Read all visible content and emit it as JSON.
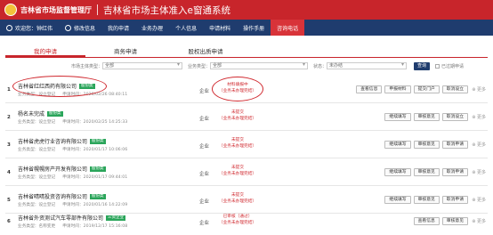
{
  "header": {
    "org_name": "吉林省市场监督管理厅",
    "system_title": "吉林省市场主体准入e窗通系统"
  },
  "menu": [
    {
      "label": "欢迎您：钟红伟",
      "icon": "user-icon"
    },
    {
      "label": "修改信息",
      "icon": "edit-icon"
    },
    {
      "label": "我的申请",
      "icon": ""
    },
    {
      "label": "业务办理",
      "icon": ""
    },
    {
      "label": "个人信息",
      "icon": ""
    },
    {
      "label": "申请材料",
      "icon": ""
    },
    {
      "label": "操作手册",
      "icon": ""
    },
    {
      "label": "咨询电话",
      "icon": "",
      "active": true
    }
  ],
  "tabs": [
    {
      "label": "我的申请",
      "active": true
    },
    {
      "label": "商务申请",
      "active": false
    },
    {
      "label": "股权出质申请",
      "active": false
    }
  ],
  "filters": {
    "type_label": "市场主体类型：",
    "type_value": "全部",
    "business_label": "业务类型：",
    "business_value": "全部",
    "status_label": "状态：",
    "status_value": "未办结",
    "query_label": "查询",
    "expired_label": "已过期申请"
  },
  "rows": [
    {
      "num": "1",
      "name": "吉林省红红西药有限公司",
      "badge": "股份类",
      "badge_color": "green",
      "type": "业务类型：设立登记",
      "date": "申请时间：2020/02/26 08:40:11",
      "category": "企业",
      "status": "材料填报中\n（业务未办理完结）",
      "ops": [
        "查看信息",
        "申报材料",
        "提交门户",
        "取消设立"
      ],
      "more": "更多"
    },
    {
      "num": "2",
      "name": "杨名未完成",
      "badge": "股份类",
      "badge_color": "green",
      "type": "业务类型：设立登记",
      "date": "申请时间：2020/02/25 14:25:33",
      "category": "企业",
      "status": "未提交\n（业务未办理完结）",
      "ops": [
        "继续填写",
        "审核意见",
        "取消设立"
      ],
      "more": "更多"
    },
    {
      "num": "3",
      "name": "吉林省虎虎行业咨询有限公司",
      "badge": "股份类",
      "badge_color": "green",
      "type": "业务类型：设立登记",
      "date": "申请时间：2020/01/17 10:06:06",
      "category": "企业",
      "status": "未提交\n（业务未办理完结）",
      "ops": [
        "继续填写",
        "审核意见",
        "取消申请"
      ],
      "more": "更多"
    },
    {
      "num": "4",
      "name": "吉林省幌幌房产开发有限公司",
      "badge": "股份类",
      "badge_color": "green",
      "type": "业务类型：设立登记",
      "date": "申请时间：2020/01/17 09:44:01",
      "category": "企业",
      "status": "未提交\n（业务未办理完结）",
      "ops": [
        "继续填写",
        "审核意见",
        "取消申请"
      ],
      "more": "更多"
    },
    {
      "num": "5",
      "name": "吉林省晴晴投资咨询有限公司",
      "badge": "股份类",
      "badge_color": "green",
      "type": "业务类型：设立登记",
      "date": "申请时间：2020/01/16 14:22:09",
      "category": "企业",
      "status": "未提交\n（业务未办理完结）",
      "ops": [
        "继续填写",
        "审核意见",
        "取消申请"
      ],
      "more": "更多"
    },
    {
      "num": "6",
      "name": "吉林省外资测试汽车零部件有限公司",
      "badge": "三资企业",
      "badge_color": "green",
      "type": "业务类型：名称变更",
      "date": "申请时间：2019/12/17 15:16:08",
      "category": "企业",
      "status": "已审核（通过）\n（业务未办理完结）",
      "ops": [
        "查看信息",
        "审核意见"
      ],
      "more": "更多"
    }
  ],
  "colors": {
    "brand_red": "#c8252b",
    "nav_blue": "#1f3c6e"
  }
}
